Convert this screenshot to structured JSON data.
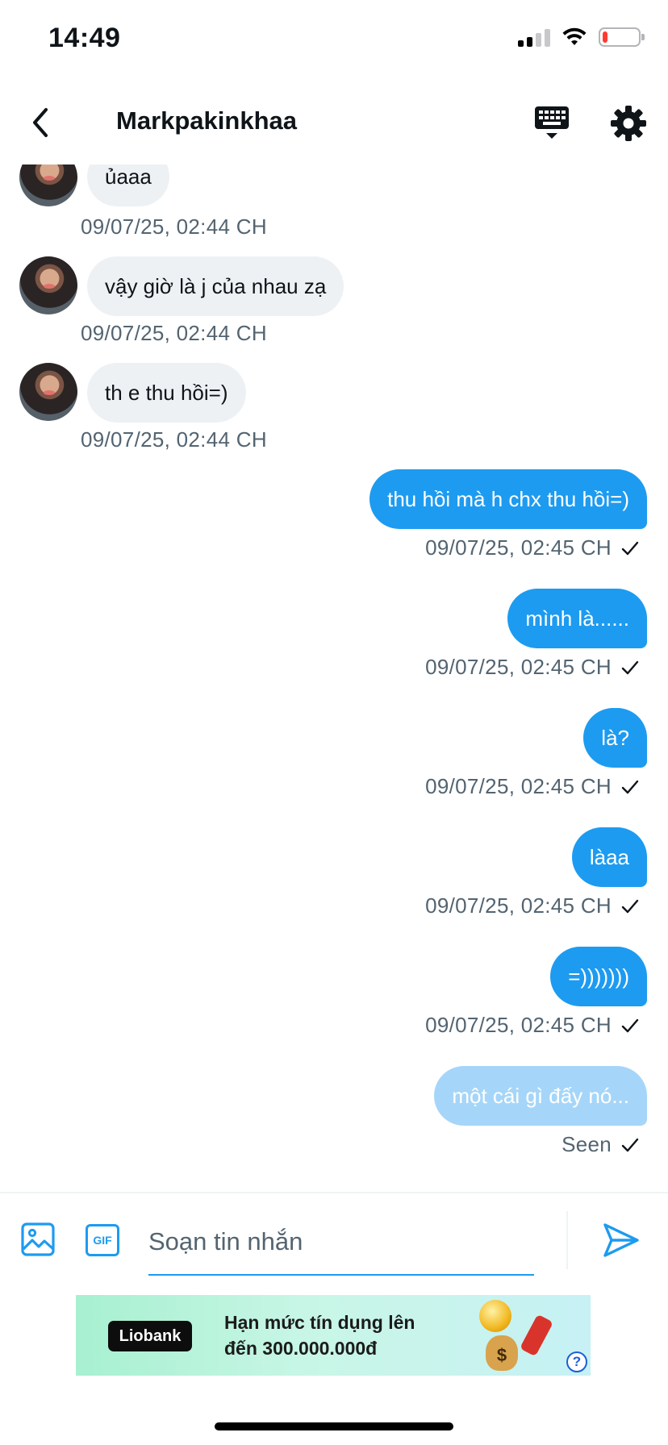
{
  "status_bar": {
    "time": "14:49",
    "battery_level": 0.15
  },
  "header": {
    "title": "Markpakinkhaa"
  },
  "messages": [
    {
      "direction": "in",
      "text": "ủaaa",
      "time": "09/07/25, 02:44 CH"
    },
    {
      "direction": "in",
      "text": "vậy giờ là j của nhau zạ",
      "time": "09/07/25, 02:44 CH"
    },
    {
      "direction": "in",
      "text": "th e thu hồi=)",
      "time": "09/07/25, 02:44 CH"
    },
    {
      "direction": "out",
      "text": "thu hồi mà h chx thu hồi=)",
      "time": "09/07/25, 02:45 CH"
    },
    {
      "direction": "out",
      "text": "mình là......",
      "time": "09/07/25, 02:45 CH"
    },
    {
      "direction": "out",
      "text": "là?",
      "time": "09/07/25, 02:45 CH"
    },
    {
      "direction": "out",
      "text": "làaa",
      "time": "09/07/25, 02:45 CH"
    },
    {
      "direction": "out",
      "text": "=)))))))",
      "time": "09/07/25, 02:45 CH"
    },
    {
      "direction": "out",
      "text": "một cái gì đấy nó...",
      "time": "Seen",
      "pending": true
    }
  ],
  "composer": {
    "placeholder": "Soạn tin nhắn",
    "value": "",
    "gif_label": "GIF"
  },
  "ad": {
    "brand": "Liobank",
    "line1": "Hạn mức tín dụng lên",
    "line2": "đến 300.000.000đ",
    "help_label": "?"
  },
  "colors": {
    "accent": "#1d9bf0",
    "incoming_bubble": "#eef1f4",
    "timestamp": "#536471",
    "pending_bubble": "#a5d6f9"
  },
  "icons": {
    "back": "chevron-left-icon",
    "keyboard": "keyboard-icon",
    "settings": "gear-icon",
    "image": "image-icon",
    "gif": "gif-icon",
    "send": "send-icon",
    "read": "check-icon"
  }
}
